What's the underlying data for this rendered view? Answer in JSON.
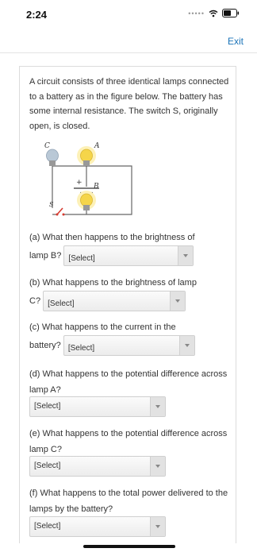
{
  "status": {
    "time": "2:24"
  },
  "header": {
    "exit_label": "Exit"
  },
  "problem": {
    "intro": "A circuit consists of three identical lamps connected to a battery as in the figure below. The battery has some internal resistance. The switch S, originally open, is closed.",
    "figure_labels": {
      "lamp_a": "A",
      "lamp_b": "B",
      "lamp_c": "C",
      "switch": "S",
      "battery_plus": "+"
    }
  },
  "questions": [
    {
      "text_a": "(a) What then happens to the brightness of",
      "text_b": "lamp B?",
      "select": "[Select]"
    },
    {
      "text_a": "(b) What happens to the brightness of lamp",
      "text_b": "C?",
      "select": "[Select]"
    },
    {
      "text_a": "(c) What happens to the current in the",
      "text_b": "battery?",
      "select": "[Select]"
    },
    {
      "text_a": "(d) What happens to the potential difference across lamp A?",
      "select": "[Select]"
    },
    {
      "text_a": "(e) What happens to the potential difference across lamp C?",
      "select": "[Select]"
    },
    {
      "text_a": "(f) What happens to the total power delivered to the lamps by the battery?",
      "select": "[Select]"
    }
  ]
}
